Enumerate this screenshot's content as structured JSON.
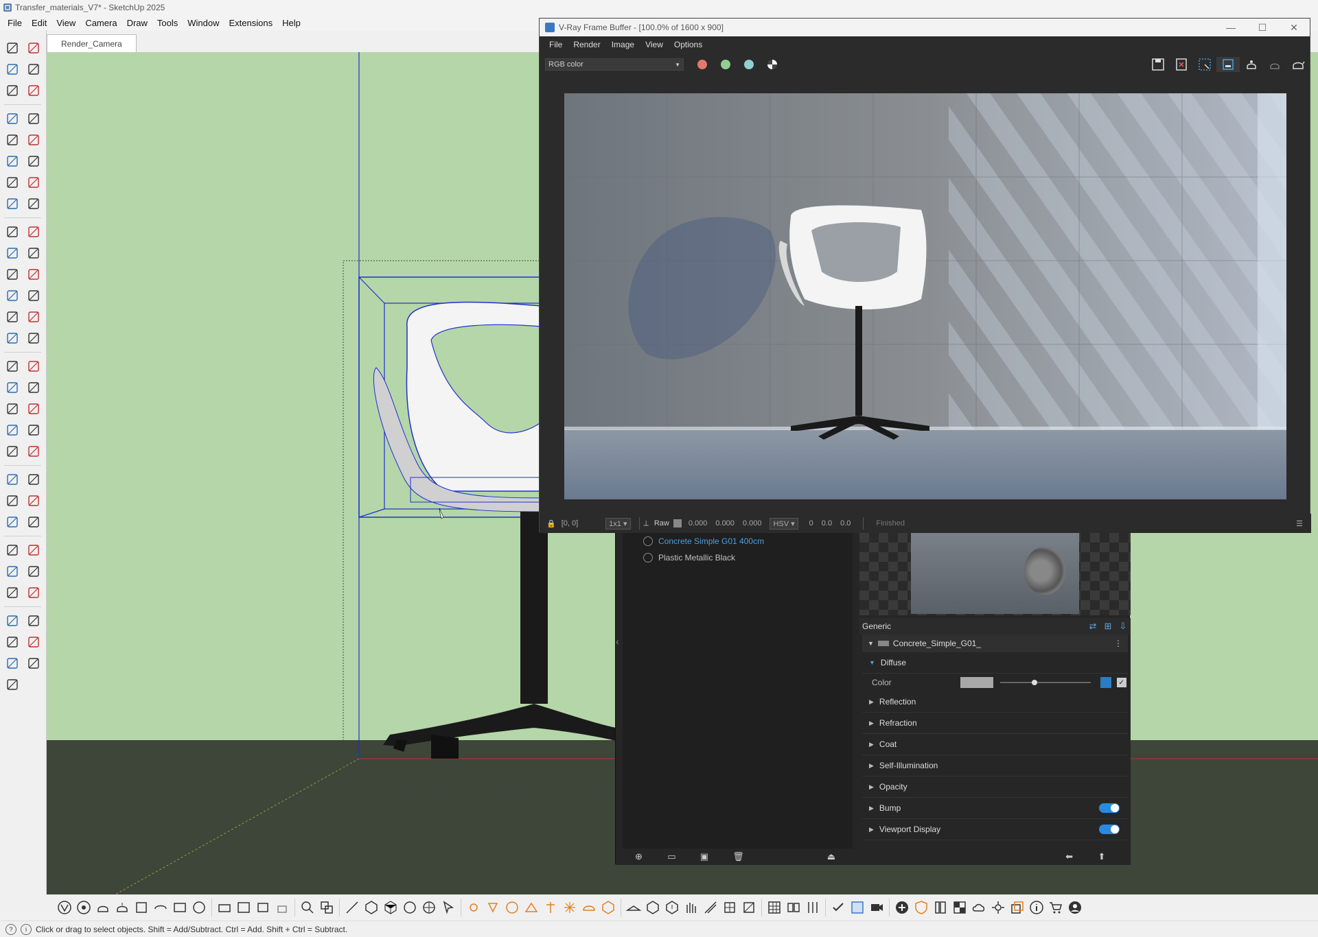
{
  "app": {
    "window_title": "Transfer_materials_V7* - SketchUp 2025",
    "menus": [
      "File",
      "Edit",
      "View",
      "Camera",
      "Draw",
      "Tools",
      "Window",
      "Extensions",
      "Help"
    ],
    "scene_tab": "Render_Camera",
    "status_text": "Click or drag to select objects. Shift = Add/Subtract. Ctrl = Add. Shift + Ctrl = Subtract.",
    "viewport_bg": "#b5d6a9",
    "ground_color": "#3d4638"
  },
  "left_toolbar": {
    "icons": [
      "select-icon",
      "lasso-select-icon",
      "paint-bucket-icon",
      "eraser-icon",
      "component-icon",
      "tag-eraser-icon",
      "pencil-line-icon",
      "freehand-icon",
      "rectangle-icon",
      "rotated-rectangle-icon",
      "circle-icon",
      "polygon-icon",
      "arc-icon",
      "pie-icon",
      "two-point-arc-icon",
      "three-point-arc-icon",
      "move-icon",
      "push-pull-icon",
      "rotate-icon",
      "follow-me-icon",
      "scale-icon",
      "offset-icon",
      "intersect-icon",
      "flip-icon",
      "tape-measure-icon",
      "dimension-icon",
      "protractor-icon",
      "text-icon",
      "axes-icon",
      "3d-text-icon",
      "orbit-icon",
      "pan-icon",
      "zoom-icon",
      "zoom-window-icon",
      "zoom-extents-icon",
      "previous-view-icon",
      "position-camera-icon",
      "walk-icon",
      "look-around-icon",
      "section-plane-icon",
      "sandbox-icon",
      "terrain-icon",
      "layers-icon",
      "stamp-icon",
      "view-iso-icon",
      "view-top-icon",
      "view-front-icon",
      "view-right-icon",
      "view-back-icon",
      "view-left-icon",
      "view-bottom-icon",
      "shaded-icon",
      "xray-icon",
      "wireframe-icon",
      "monochrome-icon",
      "hidden-line-icon",
      "textured-icon"
    ]
  },
  "vfb": {
    "title": "V-Ray Frame Buffer - [100.0% of 1600 x 900]",
    "menus": [
      "File",
      "Render",
      "Image",
      "View",
      "Options"
    ],
    "channel": "RGB color",
    "status": {
      "coords": "[0, 0]",
      "sampling": "1x1",
      "raw_label": "Raw",
      "r": "0.000",
      "g": "0.000",
      "b": "0.000",
      "color_mode": "HSV",
      "h": "0",
      "s": "0.0",
      "v": "0.0",
      "state": "Finished"
    }
  },
  "material_editor": {
    "materials": [
      {
        "name": "Concrete Simple G01 400cm",
        "selected": true
      },
      {
        "name": "Plastic Metallic Black",
        "selected": false
      }
    ],
    "generic_label": "Generic",
    "material_name": "Concrete_Simple_G01_",
    "sections": [
      {
        "label": "Diffuse",
        "open": true
      },
      {
        "label": "Reflection",
        "open": false
      },
      {
        "label": "Refraction",
        "open": false
      },
      {
        "label": "Coat",
        "open": false
      },
      {
        "label": "Self-Illumination",
        "open": false
      },
      {
        "label": "Opacity",
        "open": false
      },
      {
        "label": "Bump",
        "open": false,
        "toggle": true
      },
      {
        "label": "Viewport Display",
        "open": false,
        "toggle": true
      }
    ],
    "color_label": "Color",
    "diffuse_color": "#a8a8a8"
  }
}
